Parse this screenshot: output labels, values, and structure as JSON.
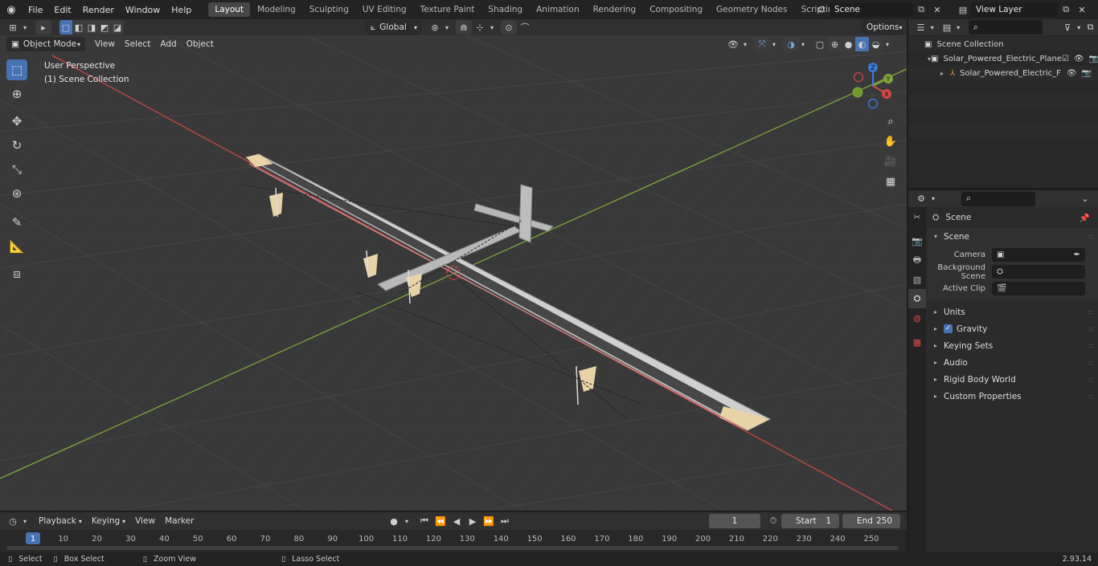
{
  "menu": {
    "items": [
      "File",
      "Edit",
      "Render",
      "Window",
      "Help"
    ]
  },
  "workspaces": [
    "Layout",
    "Modeling",
    "Sculpting",
    "UV Editing",
    "Texture Paint",
    "Shading",
    "Animation",
    "Rendering",
    "Compositing",
    "Geometry Nodes",
    "Scripting"
  ],
  "scene_field": "Scene",
  "view_layer_field": "View Layer",
  "viewport_header": {
    "transform_orientation": "Global",
    "options_label": "Options"
  },
  "viewport_header2": {
    "mode": "Object Mode",
    "menus": [
      "View",
      "Select",
      "Add",
      "Object"
    ]
  },
  "viewport_overlay": {
    "perspective": "User Perspective",
    "collection": "(1) Scene Collection"
  },
  "gizmo": {
    "x": "X",
    "y": "Y",
    "z": "Z"
  },
  "outliner": {
    "root": "Scene Collection",
    "collection": "Solar_Powered_Electric_Plane",
    "object": "Solar_Powered_Electric_F"
  },
  "properties": {
    "context_title": "Scene",
    "panel_scene": "Scene",
    "camera_label": "Camera",
    "background_scene_label": "Background Scene",
    "active_clip_label": "Active Clip",
    "panels": [
      "Units",
      "Gravity",
      "Keying Sets",
      "Audio",
      "Rigid Body World",
      "Custom Properties"
    ]
  },
  "timeline": {
    "menus": [
      "Playback",
      "Keying",
      "View",
      "Marker"
    ],
    "current_frame": "1",
    "start_label": "Start",
    "start_value": "1",
    "end_label": "End",
    "end_value": "250",
    "ticks": [
      "1",
      "10",
      "20",
      "30",
      "40",
      "50",
      "60",
      "70",
      "80",
      "90",
      "100",
      "110",
      "120",
      "130",
      "140",
      "150",
      "160",
      "170",
      "180",
      "190",
      "200",
      "210",
      "220",
      "230",
      "240",
      "250"
    ]
  },
  "statusbar": {
    "select": "Select",
    "box_select": "Box Select",
    "zoom_view": "Zoom View",
    "lasso_select": "Lasso Select",
    "version": "2.93.14"
  },
  "colors": {
    "accent": "#4772b3",
    "axis_x": "#c44a4a",
    "axis_y": "#7ea53a"
  }
}
